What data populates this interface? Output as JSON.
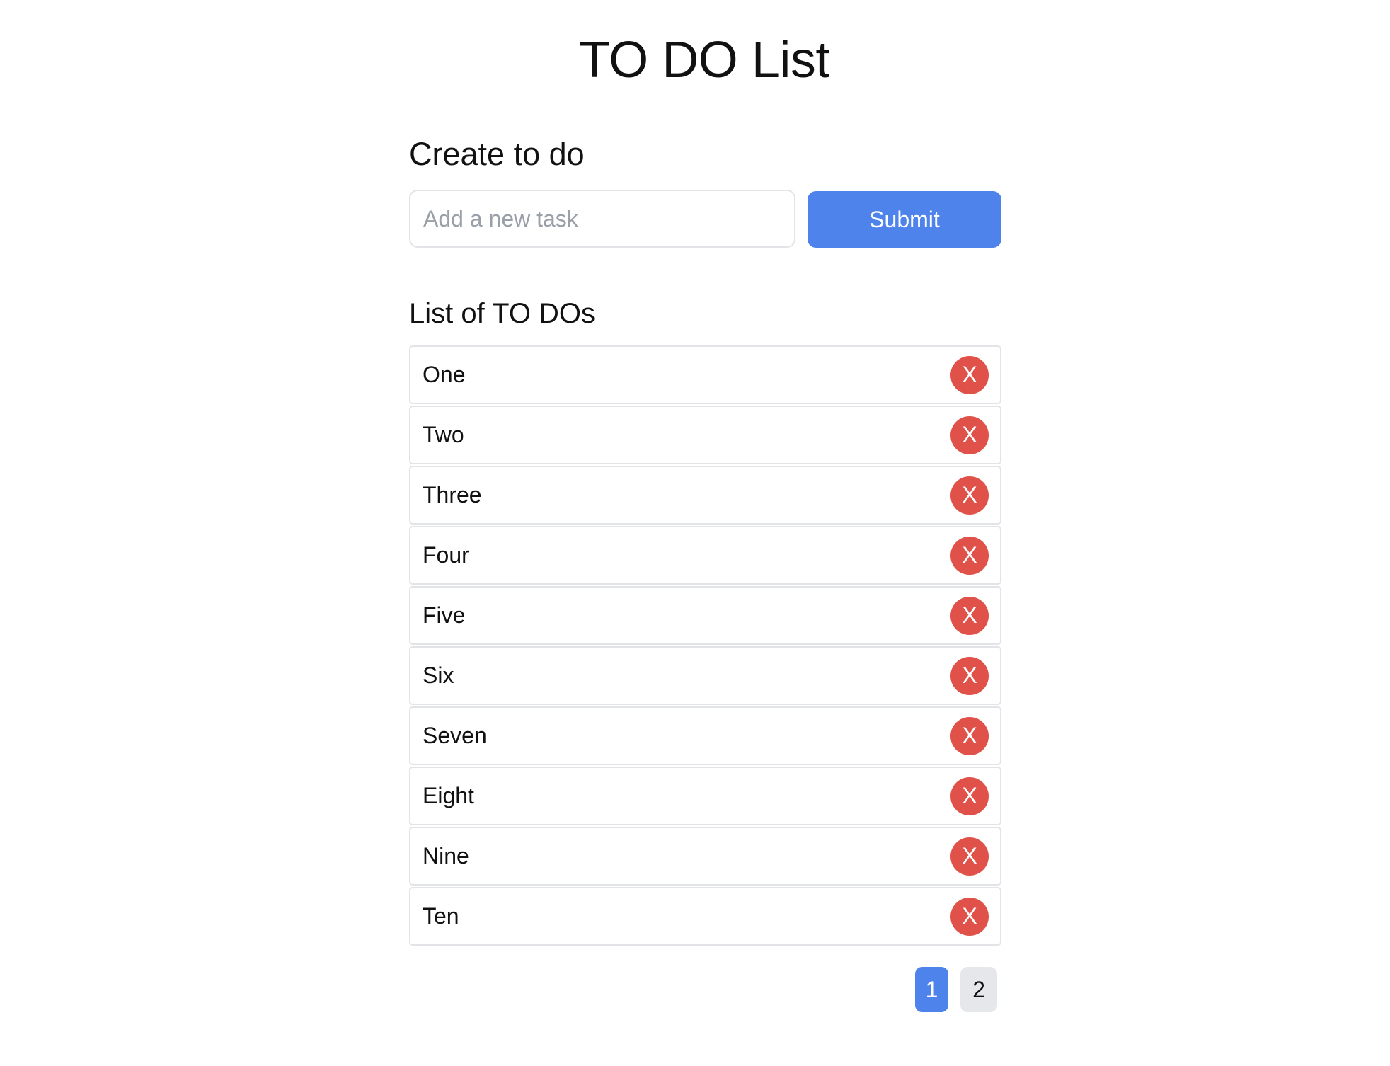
{
  "header": {
    "title": "TO DO List"
  },
  "create": {
    "heading": "Create to do",
    "input_value": "",
    "input_placeholder": "Add a new task",
    "submit_label": "Submit"
  },
  "list": {
    "heading": "List of TO DOs",
    "delete_label": "X",
    "items": [
      {
        "label": "One"
      },
      {
        "label": "Two"
      },
      {
        "label": "Three"
      },
      {
        "label": "Four"
      },
      {
        "label": "Five"
      },
      {
        "label": "Six"
      },
      {
        "label": "Seven"
      },
      {
        "label": "Eight"
      },
      {
        "label": "Nine"
      },
      {
        "label": "Ten"
      }
    ]
  },
  "pagination": {
    "pages": [
      {
        "label": "1",
        "active": true
      },
      {
        "label": "2",
        "active": false
      }
    ]
  },
  "colors": {
    "accent": "#4f83ec",
    "danger": "#e05249",
    "border": "#e3e4e8",
    "page_inactive_bg": "#e6e7ea"
  },
  "icons": {
    "delete": "close-icon"
  }
}
